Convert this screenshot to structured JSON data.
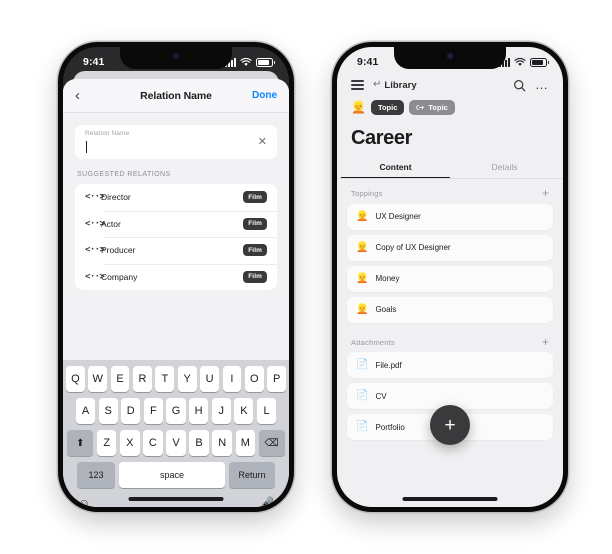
{
  "left_phone": {
    "status_bar": {
      "time": "9:41"
    },
    "nav": {
      "back_icon": "chevron-left-icon",
      "title": "Relation Name",
      "done_label": "Done"
    },
    "input": {
      "floating_label": "Relation Name",
      "value": "",
      "placeholder": "",
      "clear_icon": "close-x-icon"
    },
    "section_label": "SUGGESTED RELATIONS",
    "suggestions": [
      {
        "icon": "relation-icon",
        "glyph": "<··>",
        "name": "Director",
        "chip": "Film"
      },
      {
        "icon": "relation-icon",
        "glyph": "<··>",
        "name": "Actor",
        "chip": "Film"
      },
      {
        "icon": "relation-icon",
        "glyph": "<··>",
        "name": "Producer",
        "chip": "Film"
      },
      {
        "icon": "relation-icon",
        "glyph": "<··>",
        "name": "Company",
        "chip": "Film"
      }
    ],
    "keyboard": {
      "row1": [
        "Q",
        "W",
        "E",
        "R",
        "T",
        "Y",
        "U",
        "I",
        "O",
        "P"
      ],
      "row2": [
        "A",
        "S",
        "D",
        "F",
        "G",
        "H",
        "J",
        "K",
        "L"
      ],
      "row3": [
        "Z",
        "X",
        "C",
        "V",
        "B",
        "N",
        "M"
      ],
      "shift_icon": "shift-up-icon",
      "backspace_icon": "backspace-icon",
      "numbers_label": "123",
      "space_label": "space",
      "return_label": "Return",
      "emoji_icon": "emoji-smiley-icon",
      "mic_icon": "microphone-icon"
    }
  },
  "right_phone": {
    "status_bar": {
      "time": "9:41"
    },
    "header": {
      "menu_icon": "hamburger-menu-icon",
      "breadcrumb_icon": "arrow-down-curve-icon",
      "breadcrumb_label": "Library",
      "search_icon": "search-icon",
      "more_icon": "more-horizontal-icon"
    },
    "badges": {
      "avatar_emoji": "👱",
      "items": [
        {
          "label": "Topic",
          "style": "dark",
          "icon": null
        },
        {
          "label": "Topic",
          "style": "grey",
          "icon": "link-chain-icon"
        }
      ]
    },
    "page_title": "Career",
    "tabs": [
      {
        "label": "Content",
        "active": true
      },
      {
        "label": "Details",
        "active": false
      }
    ],
    "sections": [
      {
        "title": "Toppings",
        "add_icon": "plus-icon",
        "items": [
          {
            "icon": "person-emoji",
            "emoji": "👱",
            "name": "UX Designer"
          },
          {
            "icon": "person-emoji",
            "emoji": "👱",
            "name": "Copy of UX Designer"
          },
          {
            "icon": "person-emoji",
            "emoji": "👱",
            "name": "Money"
          },
          {
            "icon": "person-emoji",
            "emoji": "👱",
            "name": "Goals"
          }
        ]
      },
      {
        "title": "Attachments",
        "add_icon": "plus-icon",
        "items": [
          {
            "icon": "document-icon",
            "name": "File.pdf"
          },
          {
            "icon": "document-icon",
            "name": "CV"
          },
          {
            "icon": "document-icon",
            "name": "Portfolio"
          }
        ]
      }
    ],
    "fab": {
      "icon": "plus-icon",
      "label": "+"
    }
  }
}
